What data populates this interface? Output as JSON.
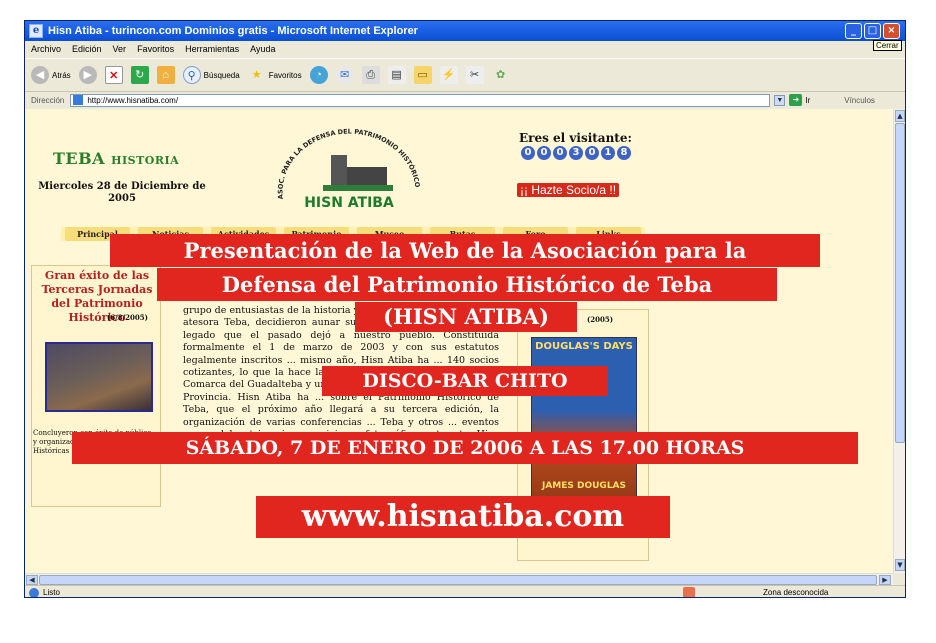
{
  "window": {
    "title": "Hisn Atiba - turincon.com Dominios gratis - Microsoft Internet Explorer",
    "app_icon": "e",
    "buttons": {
      "minimize": "_",
      "maximize": "□",
      "close": "×"
    },
    "close_tooltip": "Cerrar"
  },
  "menu": [
    "Archivo",
    "Edición",
    "Ver",
    "Favoritos",
    "Herramientas",
    "Ayuda"
  ],
  "toolbar": {
    "back_label": "Atrás",
    "search_label": "Búsqueda",
    "favorites_label": "Favoritos",
    "icons": [
      "back-arrow",
      "forward-arrow",
      "stop",
      "refresh",
      "home",
      "search",
      "favorites-star",
      "history",
      "mail",
      "print",
      "edit",
      "discuss",
      "messenger"
    ]
  },
  "address": {
    "label": "Dirección",
    "url": "http://www.hisnatiba.com/",
    "go_label": "Ir",
    "links_label": "Vínculos"
  },
  "site": {
    "brand": "TEBA",
    "brand_sub": "HISTORIA",
    "date": "Miercoles 28 de Diciembre de 2005",
    "logo_arc": "ASOC. PARA LA DEFENSA DEL PATRIMONIO HISTÓRICO",
    "logo_name": "HISN ATIBA",
    "visitor_label": "Eres el visitante:",
    "visitor_digits": [
      "0",
      "0",
      "0",
      "3",
      "0",
      "1",
      "8"
    ],
    "join_link": "¡¡ Hazte Socio/a !!",
    "nav": [
      "Principal",
      "Noticias",
      "Actividades",
      "Patrimonio",
      "Museo",
      "Rutas",
      "Foro",
      "Links"
    ],
    "left": {
      "title": "Gran éxito de las Terceras Jornadas del Patrimonio Histórico",
      "date": "(6/8/2005)",
      "text": "Concluyeron con éxito de público y organización las III Jornadas ... Históricas ..."
    },
    "center_text": "grupo de entusiastas de la historia y del patrimonio histórico que atesora Teba, decidieron aunar sus esfuerzos para relanzar el legado que el pasado dejó a nuestro pueblo. Constituida formalmente el 1 de marzo de 2003 y con sus estatutos legalmente inscritos ... mismo año, Hisn Atiba ha ... 140 socios cotizantes, lo que la hace la principal Asociación cultural de la Comarca del Guadalteba y una de las más importantes de toda la Provincia. Hisn Atiba ha ... sobre el Patrimonio Histórico de Teba, que el próximo año llegará a su tercera edición, la organización de varias conferencias ... Teba y otros ... eventos prov... del patrimonio, exposiciones fotográficas, etc. etc. Hisn Atiba se dedica, también, a otras muchas actividades como",
    "right": {
      "year": "(2005)",
      "poster_top": "DOUGLAS'S DAYS",
      "poster_bottom": "JAMES DOUGLAS"
    }
  },
  "banners": {
    "line1": "Presentación de la Web de la Asociación para la",
    "line2": "Defensa del Patrimonio Histórico de Teba",
    "line3": "(HISN ATIBA)",
    "place": "DISCO-BAR CHITO",
    "datetime": "SÁBADO, 7 DE ENERO DE 2006 A LAS 17.00 HORAS",
    "website": "www.hisnatiba.com"
  },
  "status": {
    "text": "Listo",
    "zone": "Zona desconocida"
  },
  "colors": {
    "titlebar": "#0a4fd1",
    "banner": "#e0261e",
    "page_bg": "#fff7d6",
    "visitor_digit": "#3e63c5"
  }
}
